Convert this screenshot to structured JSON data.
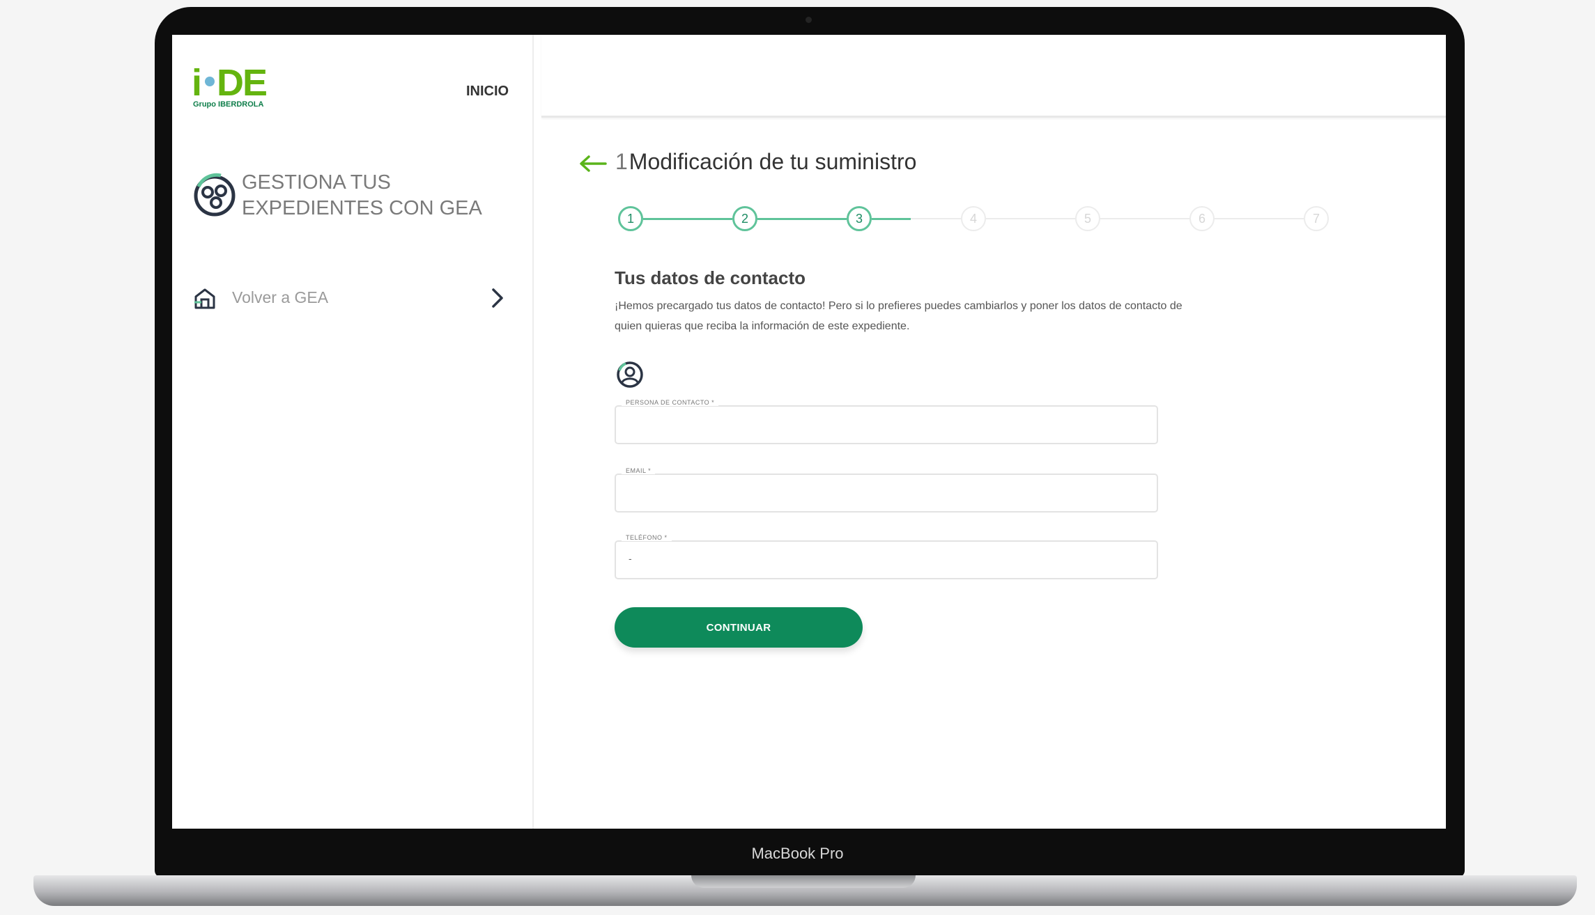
{
  "device": {
    "label": "MacBook Pro"
  },
  "logo": {
    "brand_i": "i",
    "brand_de": "DE",
    "group": "Grupo IBERDROLA"
  },
  "nav": {
    "inicio": "INICIO"
  },
  "sidebar": {
    "title": "GESTIONA TUS EXPEDIENTES CON GEA",
    "back_link": "Volver a GEA"
  },
  "page": {
    "cursor": "1",
    "title": "Modificación de tu suministro"
  },
  "stepper": {
    "current": 3,
    "steps": [
      "1",
      "2",
      "3",
      "4",
      "5",
      "6",
      "7"
    ],
    "color_done": "#5fc39a"
  },
  "contact": {
    "title": "Tus datos de contacto",
    "description": "¡Hemos precargado tus datos de contacto! Pero si lo prefieres puedes cambiarlos y poner los datos de contacto de quien quieras que reciba la información de este expediente."
  },
  "form": {
    "fields": [
      {
        "label": "PERSONA DE CONTACTO *",
        "value": ""
      },
      {
        "label": "EMAIL *",
        "value": ""
      },
      {
        "label": "TELÉFONO *",
        "value": "-"
      }
    ],
    "submit": "CONTINUAR"
  },
  "colors": {
    "brand_green": "#64b40f",
    "button_green": "#0e8a5a"
  }
}
